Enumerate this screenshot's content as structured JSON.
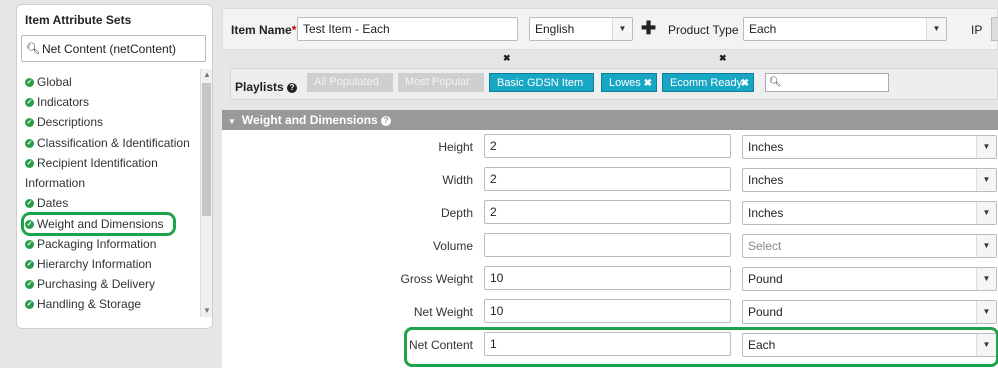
{
  "sidebar": {
    "title": "Item Attribute Sets",
    "search_value": "Net Content (netContent)",
    "items": [
      {
        "label": "Global",
        "checked": true
      },
      {
        "label": "Indicators",
        "checked": true
      },
      {
        "label": "Descriptions",
        "checked": true
      },
      {
        "label": "Classification & Identification",
        "checked": true
      },
      {
        "label": "Recipient Identification",
        "checked": true
      },
      {
        "label": "Information",
        "checked": false
      },
      {
        "label": "Dates",
        "checked": true
      },
      {
        "label": "Weight and Dimensions",
        "checked": true
      },
      {
        "label": "Packaging Information",
        "checked": true
      },
      {
        "label": "Hierarchy Information",
        "checked": true
      },
      {
        "label": "Purchasing & Delivery",
        "checked": true
      },
      {
        "label": "Handling & Storage",
        "checked": true
      }
    ]
  },
  "header": {
    "item_name_label": "Item Name",
    "required_mark": "*",
    "item_name_value": "Test Item - Each",
    "language_value": "English",
    "product_type_label": "Product Type",
    "product_type_value": "Each",
    "ip_label": "IP"
  },
  "playlists": {
    "label": "Playlists",
    "items": [
      {
        "label": "All Populated",
        "active": false
      },
      {
        "label": "Most Popular",
        "active": false
      },
      {
        "label": "Basic GDSN Item",
        "active": true
      },
      {
        "label": "Lowes",
        "active": true
      },
      {
        "label": "Ecomm Ready",
        "active": true
      }
    ],
    "search_value": ""
  },
  "section": {
    "title": "Weight and Dimensions",
    "rows": [
      {
        "label": "Height",
        "value": "2",
        "unit": "Inches"
      },
      {
        "label": "Width",
        "value": "2",
        "unit": "Inches"
      },
      {
        "label": "Depth",
        "value": "2",
        "unit": "Inches"
      },
      {
        "label": "Volume",
        "value": "",
        "unit": "Select"
      },
      {
        "label": "Gross Weight",
        "value": "10",
        "unit": "Pound"
      },
      {
        "label": "Net Weight",
        "value": "10",
        "unit": "Pound"
      },
      {
        "label": "Net Content",
        "value": "1",
        "unit": "Each"
      }
    ]
  },
  "colors": {
    "accent_green": "#1ea24a",
    "check_green": "#2a9d4a",
    "playlist_teal": "#17a6c4",
    "section_grey": "#999999"
  },
  "icons": {
    "search": "magnifier-icon",
    "check": "check-circle-icon",
    "help": "question-circle-icon",
    "remove": "close-icon",
    "dropdown": "caret-down-icon",
    "add": "plus-icon",
    "collapse": "triangle-down-icon"
  }
}
